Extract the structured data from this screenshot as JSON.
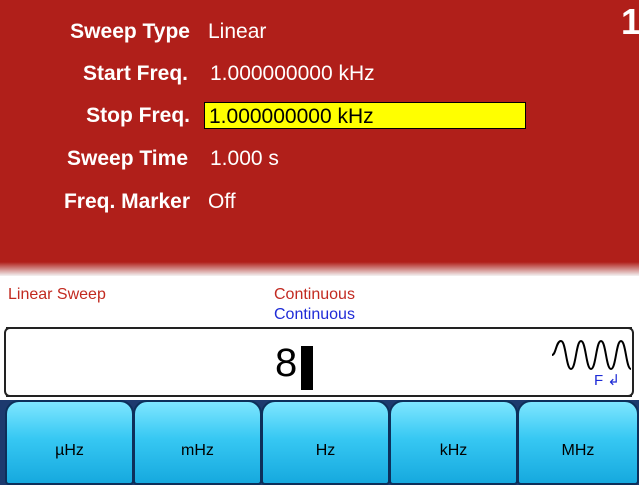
{
  "settings": {
    "sweep_type": {
      "label": "Sweep Type",
      "value": "Linear"
    },
    "start_freq": {
      "label": "Start Freq.",
      "value": "1.000000000 kHz"
    },
    "stop_freq": {
      "label": "Stop Freq.",
      "value": "1.000000000 kHz"
    },
    "sweep_time": {
      "label": "Sweep Time",
      "value": "1.000 s"
    },
    "freq_marker": {
      "label": "Freq. Marker",
      "value": "Off"
    }
  },
  "channel": "1",
  "status": {
    "mode": "Linear Sweep",
    "trigger_current": "Continuous",
    "trigger_next": "Continuous"
  },
  "entry": {
    "value": "8"
  },
  "waveform": {
    "icon": "sine-burst-icon",
    "function_label": "F",
    "arrow": "↲"
  },
  "softkeys": [
    "µHz",
    "mHz",
    "Hz",
    "kHz",
    "MHz"
  ],
  "colors": {
    "panel_bg": "#b01f1a",
    "highlight": "#ffff00",
    "mode_text": "#c22a20",
    "next_text": "#1e2bd6",
    "softkey": "#37c8f3"
  }
}
